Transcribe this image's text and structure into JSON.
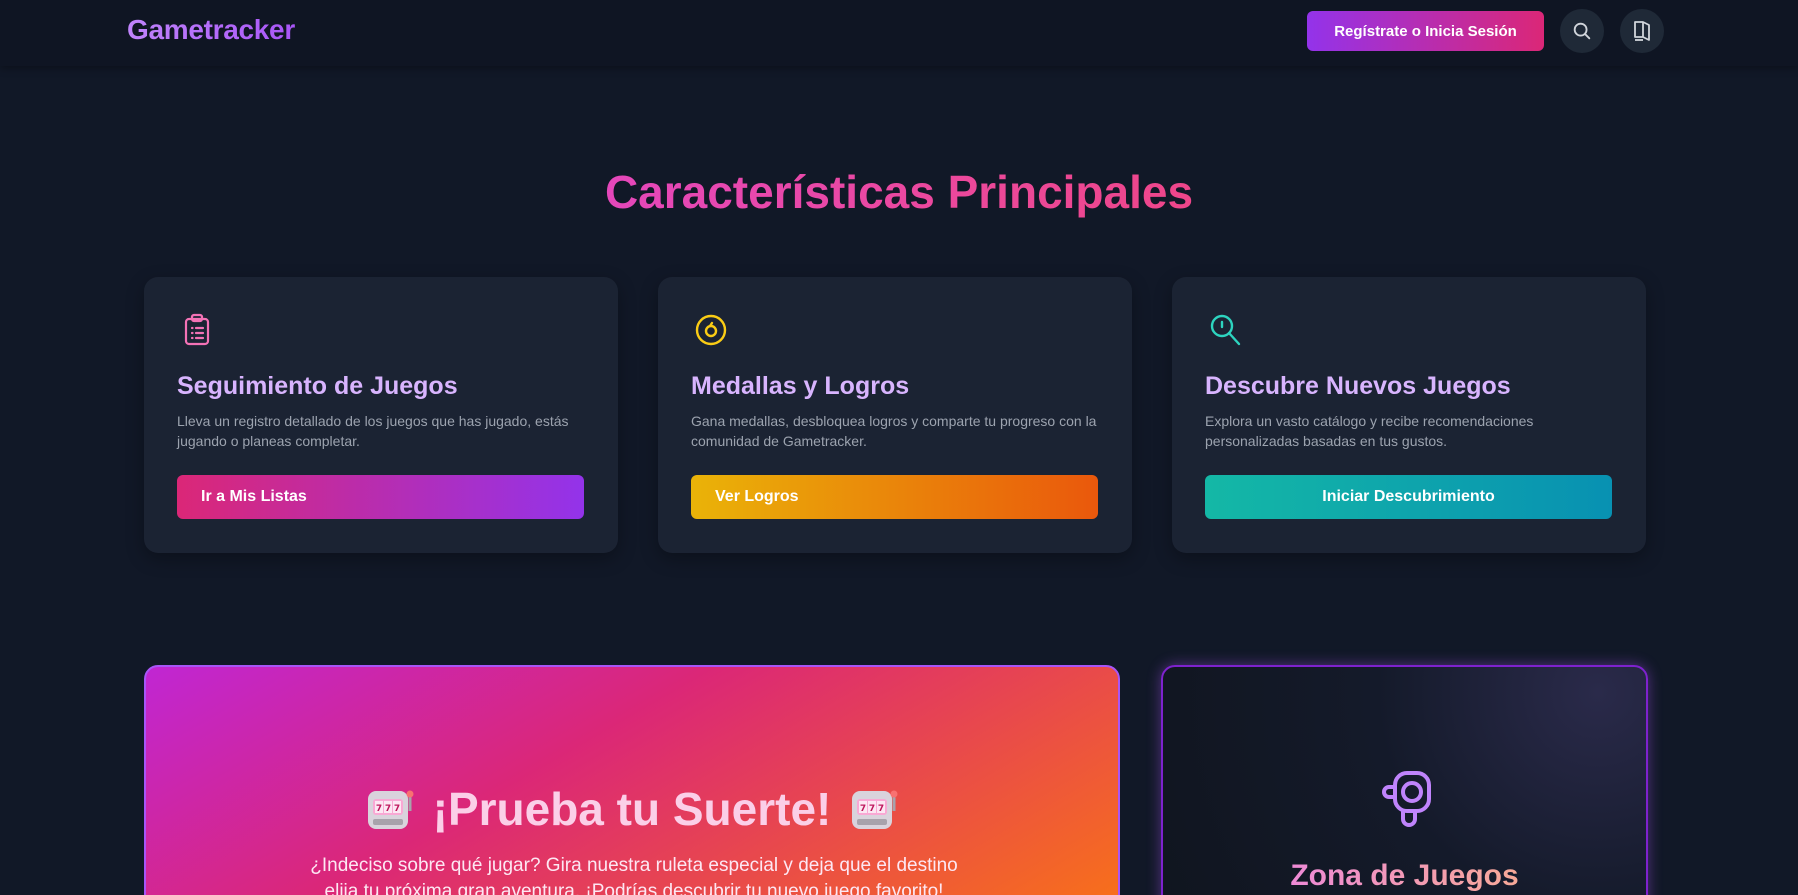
{
  "header": {
    "logo": "Gametracker",
    "auth_button": "Regístrate o Inicia Sesión",
    "search_icon": "search-icon",
    "book_icon": "book-icon"
  },
  "features": {
    "title": "Características Principales",
    "cards": [
      {
        "icon": "clipboard-list-icon",
        "title": "Seguimiento de Juegos",
        "description": "Lleva un registro detallado de los juegos que has jugado, estás jugando o planeas completar.",
        "button": "Ir a Mis Listas",
        "accent": "#f472b6"
      },
      {
        "icon": "medal-icon",
        "title": "Medallas y Logros",
        "description": "Gana medallas, desbloquea logros y comparte tu progreso con la comunidad de Gametracker.",
        "button": "Ver Logros",
        "accent": "#facc15"
      },
      {
        "icon": "search-discover-icon",
        "title": "Descubre Nuevos Juegos",
        "description": "Explora un vasto catálogo y recibe recomendaciones personalizadas basadas en tus gustos.",
        "button": "Iniciar Descubrimiento",
        "accent": "#2dd4bf"
      }
    ]
  },
  "promo": {
    "title": "¡Prueba tu Suerte!",
    "icon": "slot-machine-icon",
    "text": "¿Indeciso sobre qué jugar? Gira nuestra ruleta especial y deja que el destino elija tu próxima gran aventura. ¡Podrías descubrir tu nuevo juego favorito!"
  },
  "zone": {
    "icon": "gamepad-icon",
    "title": "Zona de Juegos"
  }
}
